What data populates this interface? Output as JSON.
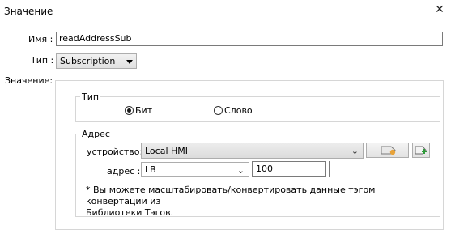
{
  "window": {
    "title": "Значение",
    "close_icon": "close-icon"
  },
  "form": {
    "name_label": "Имя :",
    "name_value": "readAddressSub",
    "type_label": "Тип :",
    "type_value": "Subscription",
    "value_label": "Значение:"
  },
  "type_group": {
    "title": "Тип",
    "options": [
      {
        "label": "Бит",
        "checked": true
      },
      {
        "label": "Слово",
        "checked": false
      }
    ]
  },
  "address_group": {
    "title": "Адрес",
    "device_label": "устройство:",
    "device_value": "Local HMI",
    "address_label": "адрес :",
    "address_type": "LB",
    "address_value": "100",
    "tag_button_icon": "tag-icon",
    "add_tag_button_icon": "add-tag-icon",
    "hint": "* Вы можете масштабировать/конвертировать данные тэгом конвертации из\nБиблиотеки Тэгов."
  },
  "colors": {
    "tag_orange": "#e8a33a",
    "add_green": "#2e9b3a",
    "border": "#d6d6d6"
  }
}
